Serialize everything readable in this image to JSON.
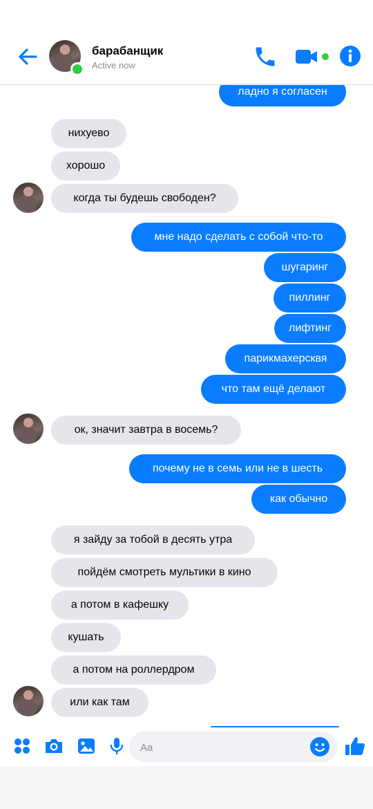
{
  "header": {
    "name": "барабанщик",
    "status": "Active now"
  },
  "composer": {
    "placeholder": "Aa"
  },
  "messages": [
    {
      "side": "out",
      "text": "ладно я согласен"
    },
    {
      "side": "in",
      "text": "нихуево"
    },
    {
      "side": "in",
      "text": "хорошо"
    },
    {
      "side": "in",
      "text": "когда ты будешь свободен?"
    },
    {
      "side": "out",
      "text": "мне надо сделать с собой что-то"
    },
    {
      "side": "out",
      "text": "шугаринг"
    },
    {
      "side": "out",
      "text": "пиллинг"
    },
    {
      "side": "out",
      "text": "лифтинг"
    },
    {
      "side": "out",
      "text": "парикмахерсквя"
    },
    {
      "side": "out",
      "text": "что там ещё делают"
    },
    {
      "side": "in",
      "text": "ок, значит завтра в восемь?"
    },
    {
      "side": "out",
      "text": "почему не в семь или не в шесть"
    },
    {
      "side": "out",
      "text": "как обычно"
    },
    {
      "side": "in",
      "text": "я зайду за тобой в десять утра"
    },
    {
      "side": "in",
      "text": "пойдём смотреть мультики в кино"
    },
    {
      "side": "in",
      "text": "а потом в кафешку"
    },
    {
      "side": "in",
      "text": "кушать"
    },
    {
      "side": "in",
      "text": "а потом на роллердром"
    },
    {
      "side": "in",
      "text": "или как там"
    }
  ],
  "colors": {
    "accent": "#0a7cff",
    "incoming_bubble": "#e4e6eb",
    "presence": "#31cc46"
  },
  "icons": {
    "back": "arrow-left-icon",
    "call": "phone-icon",
    "video": "video-camera-icon",
    "info": "info-icon",
    "menu": "four-dots-icon",
    "camera": "camera-icon",
    "gallery": "image-icon",
    "mic": "microphone-icon",
    "emoji": "smiley-icon",
    "like": "thumbs-up-icon"
  }
}
